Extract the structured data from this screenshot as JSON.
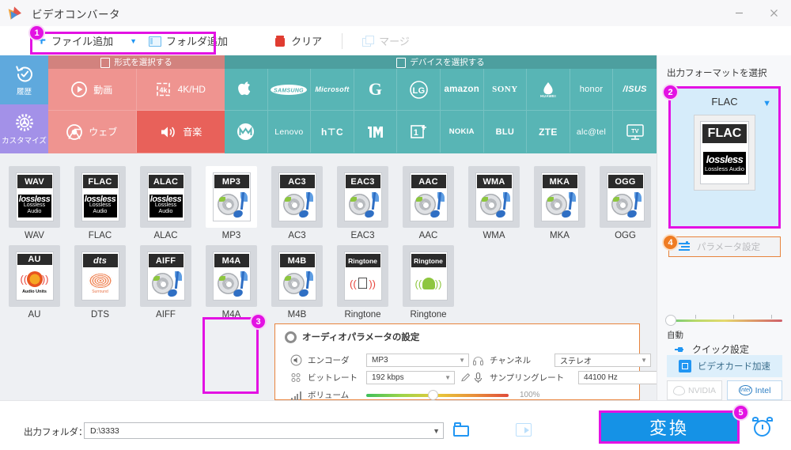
{
  "window": {
    "title": "ビデオコンバータ",
    "minimize_label": "–",
    "close_label": "✕"
  },
  "toolbar": {
    "add_file": "ファイル追加",
    "add_folder": "フォルダ追加",
    "clear": "クリア",
    "merge": "マージ"
  },
  "sidebar": {
    "items": [
      {
        "label": "履歴",
        "icon": "history-icon",
        "color": "#5fa9dd"
      },
      {
        "label": "カスタマイズ",
        "icon": "gear-icon",
        "color": "#a391e8"
      }
    ]
  },
  "categories": {
    "format_header": "形式を選択する",
    "device_header": "デバイスを選択する",
    "format_tiles": [
      {
        "label": "動画",
        "icon": "play-icon",
        "selected": false
      },
      {
        "label": "4K/HD",
        "icon": "4k-icon",
        "selected": false
      },
      {
        "label": "ウェブ",
        "icon": "chrome-icon",
        "selected": false
      },
      {
        "label": "音楽",
        "icon": "speaker-icon",
        "selected": true
      }
    ],
    "device_tiles_row1": [
      "Apple",
      "SAMSUNG",
      "Microsoft",
      "G",
      "LG",
      "amazon",
      "SONY",
      "HUAWEI",
      "honor",
      "ASUS"
    ],
    "device_tiles_row2": [
      "Motorola",
      "Lenovo",
      "hTC",
      "mi",
      "1+",
      "NOKIA",
      "BLU",
      "ZTE",
      "alcatel",
      "TV"
    ]
  },
  "formats": [
    {
      "label": "WAV",
      "tag": "WAV",
      "art": "lossless",
      "selected": false
    },
    {
      "label": "FLAC",
      "tag": "FLAC",
      "art": "lossless",
      "selected": false
    },
    {
      "label": "ALAC",
      "tag": "ALAC",
      "art": "lossless",
      "selected": false
    },
    {
      "label": "MP3",
      "tag": "MP3",
      "art": "cd",
      "selected": true
    },
    {
      "label": "AC3",
      "tag": "AC3",
      "art": "cd",
      "selected": false
    },
    {
      "label": "EAC3",
      "tag": "EAC3",
      "art": "cd",
      "selected": false
    },
    {
      "label": "AAC",
      "tag": "AAC",
      "art": "cd",
      "selected": false
    },
    {
      "label": "WMA",
      "tag": "WMA",
      "art": "cd",
      "selected": false
    },
    {
      "label": "MKA",
      "tag": "MKA",
      "art": "cd",
      "selected": false
    },
    {
      "label": "OGG",
      "tag": "OGG",
      "art": "cd",
      "selected": false
    },
    {
      "label": "AU",
      "tag": "AU",
      "art": "au",
      "selected": false
    },
    {
      "label": "DTS",
      "tag": "dts",
      "art": "dts",
      "selected": false
    },
    {
      "label": "AIFF",
      "tag": "AIFF",
      "art": "cd",
      "selected": false
    },
    {
      "label": "M4A",
      "tag": "M4A",
      "art": "cd",
      "selected": false
    },
    {
      "label": "M4B",
      "tag": "M4B",
      "art": "cd",
      "selected": false
    },
    {
      "label": "Ringtone",
      "tag": "Ringtone",
      "art": "apple",
      "selected": false
    },
    {
      "label": "Ringtone",
      "tag": "Ringtone",
      "art": "android",
      "selected": false
    }
  ],
  "audio_params": {
    "title": "オーディオパラメータの設定",
    "encoder_label": "エンコーダ",
    "encoder_value": "MP3",
    "bitrate_label": "ビットレート",
    "bitrate_value": "192 kbps",
    "volume_label": "ボリューム",
    "volume_value": "100%",
    "channel_label": "チャンネル",
    "channel_value": "ステレオ",
    "samplerate_label": "サンプリングレート",
    "samplerate_value": "44100 Hz"
  },
  "right_panel": {
    "title": "出力フォーマットを選択",
    "format_name": "FLAC",
    "format_tag": "FLAC",
    "format_sub_big": "lossless",
    "format_sub_small": "Lossless Audio",
    "param_button": "パラメータ設定",
    "quick_setting": "クイック設定",
    "speed_label": "自動",
    "gpu_button": "ビデオカード加速",
    "gpu_nvidia": "NVIDIA",
    "gpu_intel": "Intel"
  },
  "bottom": {
    "output_label": "出力フォルダ：",
    "output_path": "D:\\3333",
    "convert_label": "変換"
  },
  "callouts": [
    {
      "number": "1",
      "color": "#e312e3"
    },
    {
      "number": "2",
      "color": "#e312e3"
    },
    {
      "number": "3",
      "color": "#e312e3"
    },
    {
      "number": "4",
      "color": "#ef7c23"
    },
    {
      "number": "5",
      "color": "#e312e3"
    }
  ],
  "colors": {
    "accent_blue": "#1592e6",
    "highlight_magenta": "#e312e3",
    "highlight_orange": "#e8833c",
    "format_strip_red": "#ef9490",
    "format_strip_red_selected": "#e8615a",
    "device_strip_teal": "#58b5b5"
  }
}
